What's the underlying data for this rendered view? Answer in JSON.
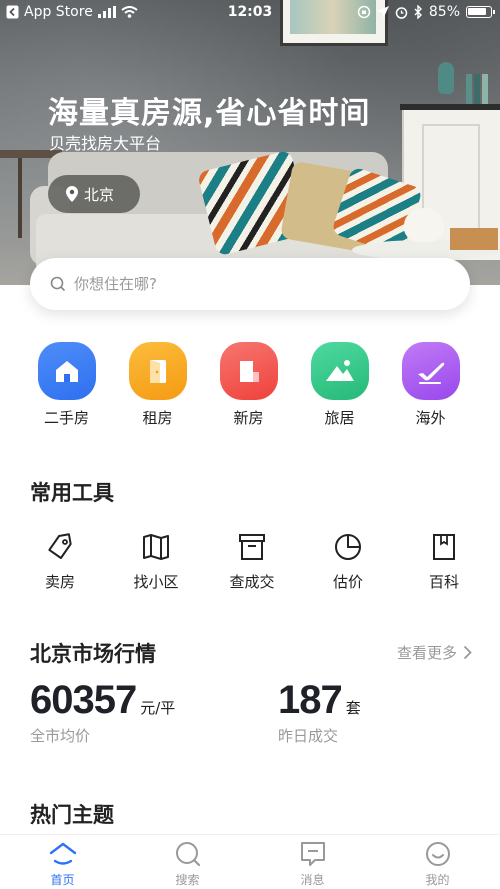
{
  "status_bar": {
    "back_app": "App Store",
    "time": "12:03",
    "battery_text": "85%",
    "battery_level": 0.85
  },
  "hero": {
    "title": "海量真房源,省心省时间",
    "subtitle": "贝壳找房大平台",
    "city": "北京"
  },
  "search": {
    "placeholder": "你想住在哪?"
  },
  "categories": [
    {
      "label": "二手房",
      "color": "#3b7cf6",
      "icon": "house-icon"
    },
    {
      "label": "租房",
      "color": "#f8a823",
      "icon": "door-icon"
    },
    {
      "label": "新房",
      "color": "#f45b55",
      "icon": "building-icon"
    },
    {
      "label": "旅居",
      "color": "#37c98b",
      "icon": "mountain-icon"
    },
    {
      "label": "海外",
      "color": "#b05ef0",
      "icon": "plane-icon"
    }
  ],
  "tools_section": {
    "title": "常用工具",
    "items": [
      {
        "label": "卖房",
        "icon": "tag-icon"
      },
      {
        "label": "找小区",
        "icon": "map-icon"
      },
      {
        "label": "查成交",
        "icon": "archive-icon"
      },
      {
        "label": "估价",
        "icon": "pie-chart-icon"
      },
      {
        "label": "百科",
        "icon": "book-icon"
      }
    ]
  },
  "market": {
    "title": "北京市场行情",
    "more_label": "查看更多",
    "avg_price": {
      "value": "60357",
      "unit": "元/平",
      "label": "全市均价"
    },
    "deals": {
      "value": "187",
      "unit": "套",
      "label": "昨日成交"
    }
  },
  "hot_topics": {
    "title": "热门主题"
  },
  "tabbar": [
    {
      "label": "首页",
      "icon": "home-icon",
      "active": true
    },
    {
      "label": "搜索",
      "icon": "search-icon",
      "active": false
    },
    {
      "label": "消息",
      "icon": "message-icon",
      "active": false
    },
    {
      "label": "我的",
      "icon": "profile-icon",
      "active": false
    }
  ],
  "colors": {
    "accent": "#3072f6",
    "muted": "#9a9a9a"
  }
}
